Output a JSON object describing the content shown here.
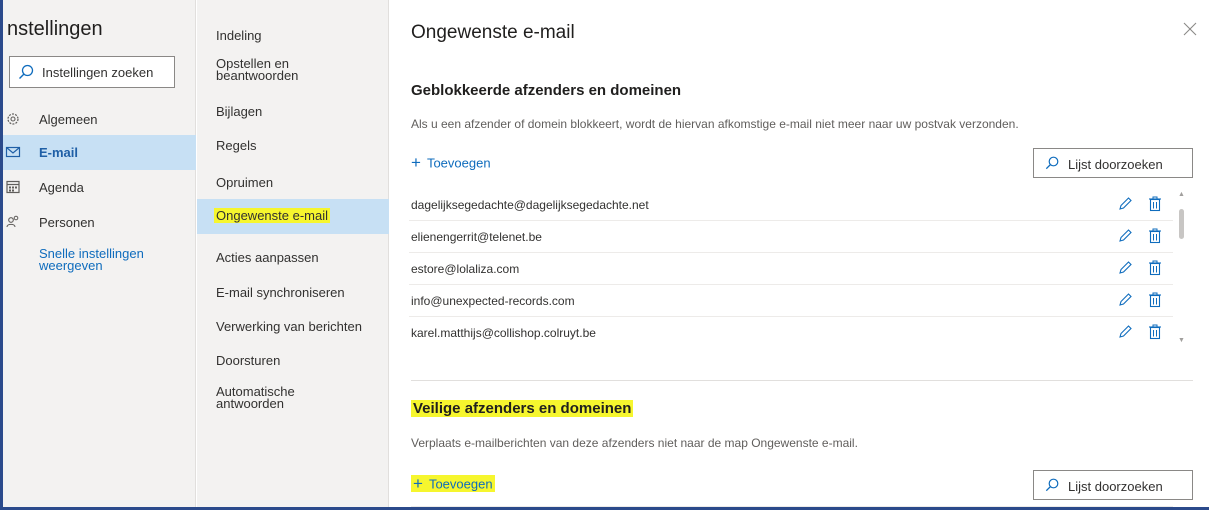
{
  "sidebar": {
    "title": "nstellingen",
    "search_placeholder": "Instellingen zoeken",
    "items": [
      {
        "label": "Algemeen",
        "icon": "gear-icon"
      },
      {
        "label": "E-mail",
        "icon": "mail-icon",
        "active": true
      },
      {
        "label": "Agenda",
        "icon": "calendar-icon"
      },
      {
        "label": "Personen",
        "icon": "people-icon"
      }
    ],
    "quick_settings": "Snelle instellingen weergeven"
  },
  "mail_nav": {
    "items": [
      {
        "label": "Indeling"
      },
      {
        "label": "Opstellen en beantwoorden"
      },
      {
        "label": "Bijlagen"
      },
      {
        "label": "Regels"
      },
      {
        "label": "Opruimen"
      },
      {
        "label": "Ongewenste e-mail",
        "active": true
      },
      {
        "label": "Acties aanpassen"
      },
      {
        "label": "E-mail synchroniseren"
      },
      {
        "label": "Verwerking van berichten"
      },
      {
        "label": "Doorsturen"
      },
      {
        "label": "Automatische antwoorden"
      }
    ]
  },
  "main": {
    "title": "Ongewenste e-mail",
    "blocked": {
      "heading": "Geblokkeerde afzenders en domeinen",
      "description": "Als u een afzender of domein blokkeert, wordt de hiervan afkomstige e-mail niet meer naar uw postvak verzonden.",
      "add_label": "Toevoegen",
      "search_label": "Lijst doorzoeken",
      "entries": [
        "dagelijksegedachte@dagelijksegedachte.net",
        "elienengerrit@telenet.be",
        "estore@lolaliza.com",
        "info@unexpected-records.com",
        "karel.matthijs@collishop.colruyt.be"
      ]
    },
    "safe": {
      "heading": "Veilige afzenders en domeinen",
      "description": "Verplaats e-mailberichten van deze afzenders niet naar de map Ongewenste e-mail.",
      "add_label": "Toevoegen",
      "search_label": "Lijst doorzoeken"
    }
  },
  "colors": {
    "accent": "#0f6cbd",
    "active_bg": "#c7e0f4",
    "highlight": "#f6f62e",
    "frame": "#2b4a8b"
  }
}
